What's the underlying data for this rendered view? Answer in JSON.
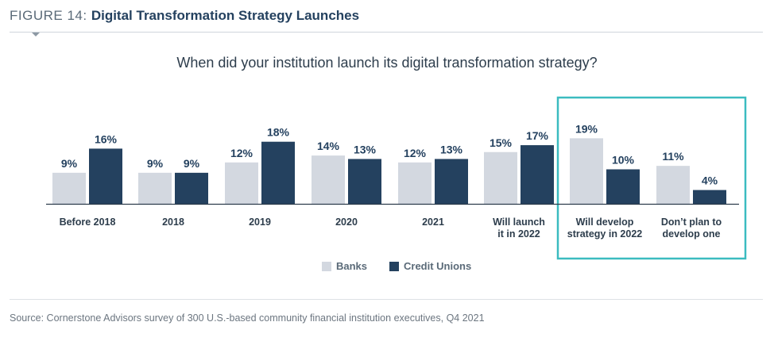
{
  "header": {
    "figure_label": "FIGURE 14:",
    "title": "Digital Transformation Strategy Launches"
  },
  "question": "When did your institution launch its digital transformation strategy?",
  "source": "Source: Cornerstone Advisors survey of 300 U.S.-based community financial institution executives, Q4 2021",
  "colors": {
    "banks": "#d3d8e0",
    "credit_unions": "#24415f",
    "highlight_box": "#3bbcc0",
    "axis": "#2d3d4c"
  },
  "chart_data": {
    "type": "bar",
    "categories": [
      [
        "Before 2018"
      ],
      [
        "2018"
      ],
      [
        "2019"
      ],
      [
        "2020"
      ],
      [
        "2021"
      ],
      [
        "Will launch",
        "it in 2022"
      ],
      [
        "Will develop",
        "strategy in 2022"
      ],
      [
        "Don’t plan to",
        "develop one"
      ]
    ],
    "series": [
      {
        "name": "Banks",
        "values": [
          9,
          9,
          12,
          14,
          12,
          15,
          19,
          11
        ]
      },
      {
        "name": "Credit Unions",
        "values": [
          16,
          9,
          18,
          13,
          13,
          17,
          10,
          4
        ]
      }
    ],
    "value_suffix": "%",
    "legend": "bottom-center",
    "grid": false,
    "highlighted_categories": [
      6,
      7
    ]
  }
}
